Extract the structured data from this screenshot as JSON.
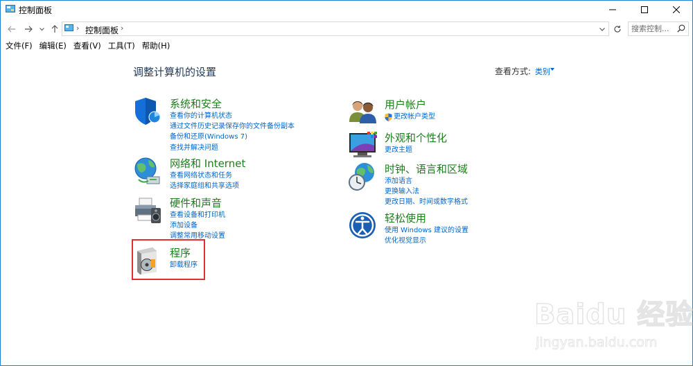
{
  "window": {
    "title": "控制面板",
    "controls": {
      "minimize": "minimize",
      "maximize": "maximize",
      "close": "close"
    }
  },
  "address": {
    "crumb": "控制面板",
    "search_placeholder": "搜索控制...",
    "icons": [
      "back-arrow-icon",
      "forward-arrow-icon",
      "chevron-down-icon",
      "up-arrow-icon",
      "refresh-icon",
      "search-icon"
    ]
  },
  "menu": [
    {
      "label": "文件(F)"
    },
    {
      "label": "编辑(E)"
    },
    {
      "label": "查看(V)"
    },
    {
      "label": "工具(T)"
    },
    {
      "label": "帮助(H)"
    }
  ],
  "main": {
    "heading": "调整计算机的设置",
    "view_by_label": "查看方式:",
    "view_by_value": "类别"
  },
  "categories": {
    "system": {
      "title": "系统和安全",
      "icon": "shield-pie-icon",
      "links": [
        "查看你的计算机状态",
        "通过文件历史记录保存你的文件备份副本",
        "备份和还原(Windows 7)",
        "查找并解决问题"
      ]
    },
    "network": {
      "title": "网络和 Internet",
      "icon": "globe-network-icon",
      "links": [
        "查看网络状态和任务",
        "选择家庭组和共享选项"
      ]
    },
    "hardware": {
      "title": "硬件和声音",
      "icon": "printer-speaker-icon",
      "links": [
        "查看设备和打印机",
        "添加设备",
        "调整常用移动设置"
      ]
    },
    "programs": {
      "title": "程序",
      "icon": "programs-disc-icon",
      "links": [
        "卸载程序"
      ]
    },
    "users": {
      "title": "用户帐户",
      "icon": "users-icon",
      "links": [
        "更改帐户类型"
      ]
    },
    "appearance": {
      "title": "外观和个性化",
      "icon": "monitor-palette-icon",
      "links": [
        "更改主题"
      ]
    },
    "clock": {
      "title": "时钟、语言和区域",
      "icon": "clock-globe-icon",
      "links": [
        "添加语言",
        "更换输入法",
        "更改日期、时间或数字格式"
      ]
    },
    "ease": {
      "title": "轻松使用",
      "icon": "ease-of-access-icon",
      "links": [
        "使用 Windows 建议的设置",
        "优化视觉显示"
      ]
    }
  },
  "watermark": {
    "brand": "Baidu 经验",
    "url": "jingyan.baidu.com"
  },
  "colors": {
    "category_title": "#1b7e1b",
    "link": "#0066cc",
    "heading": "#1e395b",
    "highlight_box": "#e0302b",
    "window_border": "#1883d7"
  }
}
